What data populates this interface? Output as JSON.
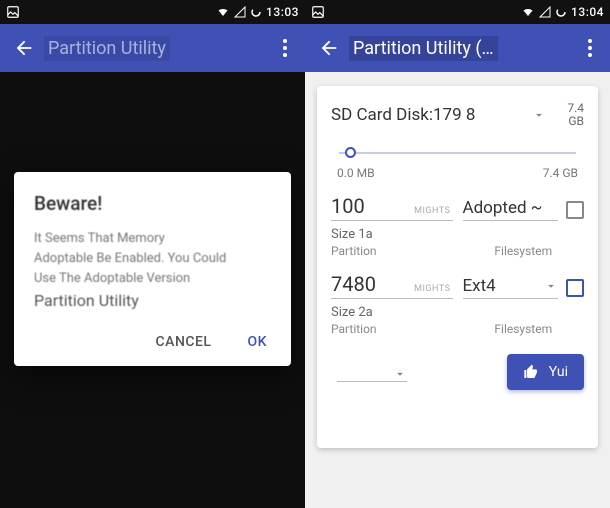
{
  "left": {
    "status": {
      "time": "13:03"
    },
    "appbar": {
      "title": "Partition Utility"
    },
    "dialog": {
      "title": "Beware!",
      "line1": "It Seems That Memory",
      "line2": "Adoptable Be Enabled. You Could",
      "line3": "Use The Adoptable Version",
      "line4": "Partition Utility",
      "cancel": "CANCEL",
      "ok": "OK"
    }
  },
  "right": {
    "status": {
      "time": "13:04"
    },
    "appbar": {
      "title": "Partition Utility (…"
    },
    "card": {
      "disk_label": "SD Card Disk:179 8",
      "disk_size_top": "7.4",
      "disk_size_bot": "GB",
      "range_min": "0.0 MB",
      "range_max": "7.4 GB",
      "p1_value": "100",
      "p1_hint": "MIGHTS",
      "p1_fs": "Adopted ~",
      "p1_size_lbl": "Size 1a",
      "p1_part_lbl": "Partition",
      "p1_fs_lbl": "Filesystem",
      "p2_value": "7480",
      "p2_hint": "MIGHTS",
      "p2_fs": "Ext4",
      "p2_size_lbl": "Size 2a",
      "p2_part_lbl": "Partition",
      "p2_fs_lbl": "Filesystem",
      "go_label": "Yui"
    }
  }
}
